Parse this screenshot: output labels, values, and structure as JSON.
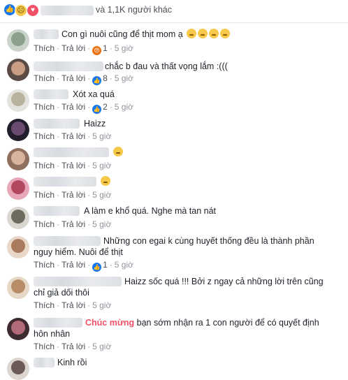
{
  "header": {
    "reactions": [
      "like",
      "sad",
      "love"
    ],
    "others_text": "và 1,1K người khác"
  },
  "actions": {
    "like": "Thích",
    "reply": "Trả lời",
    "sep": "·"
  },
  "comments": [
    {
      "text": "Con gì nuôi cũng để thịt mom ạ",
      "emoji_count": 4,
      "reaction": "angry",
      "reaction_count": "1",
      "time": "5 giờ"
    },
    {
      "text": "chắc b đau và thất vọng lắm :(((",
      "reaction": "like",
      "reaction_count": "8",
      "time": "5 giờ"
    },
    {
      "text": "Xót xa quá",
      "reaction": "like",
      "reaction_count": "2",
      "time": "5 giờ"
    },
    {
      "text": "Haizz",
      "time": "5 giờ"
    },
    {
      "text": "",
      "emoji_count": 1,
      "time": "5 giờ"
    },
    {
      "text": "",
      "emoji_count": 1,
      "time": "5 giờ"
    },
    {
      "text": "A làm e khổ quá. Nghe mà tan nát",
      "time": "5 giờ"
    },
    {
      "text": "Những con egai k cùng huyết thống đều là thành phần nguy hiểm. Nuôi để thịt",
      "reaction": "like",
      "reaction_count": "1",
      "time": "5 giờ"
    },
    {
      "text": "Haizz sốc quá !!! Bởi z ngay cả những lời trên cũng chỉ giả dối thôi",
      "time": "5 giờ"
    },
    {
      "text_congrats": "Chúc mừng",
      "text": "bạn sớm nhận ra 1 con người để có quyết định hôn nhân",
      "time": "5 giờ"
    },
    {
      "text": "Kinh rồi"
    }
  ]
}
